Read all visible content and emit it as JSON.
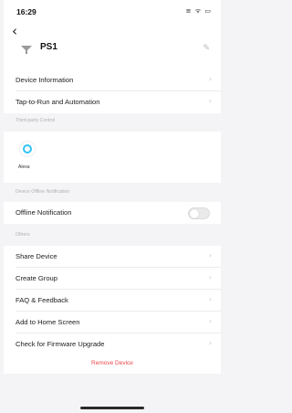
{
  "status_bar": {
    "time": "16:29",
    "icons": "≡ ᯤ ▭"
  },
  "header": {
    "back_glyph": "‹",
    "device_name": "PS1",
    "edit_glyph": "✎"
  },
  "rows_top": [
    {
      "label": "Device Information"
    },
    {
      "label": "Tap-to-Run and Automation"
    }
  ],
  "sections": {
    "third_party": "Third-party Control",
    "offline": "Device Offline Notification",
    "others": "Others"
  },
  "third_party": {
    "alexa_label": "Alexa"
  },
  "offline_notification": {
    "label": "Offline Notification",
    "enabled": false
  },
  "others_rows": [
    {
      "label": "Share Device"
    },
    {
      "label": "Create Group"
    },
    {
      "label": "FAQ & Feedback"
    },
    {
      "label": "Add to Home Screen"
    },
    {
      "label": "Check for Firmware Upgrade"
    }
  ],
  "chevron": "›",
  "remove_device": "Remove Device",
  "colors": {
    "accent_red": "#e8474a",
    "alexa_blue": "#31c4f3"
  }
}
